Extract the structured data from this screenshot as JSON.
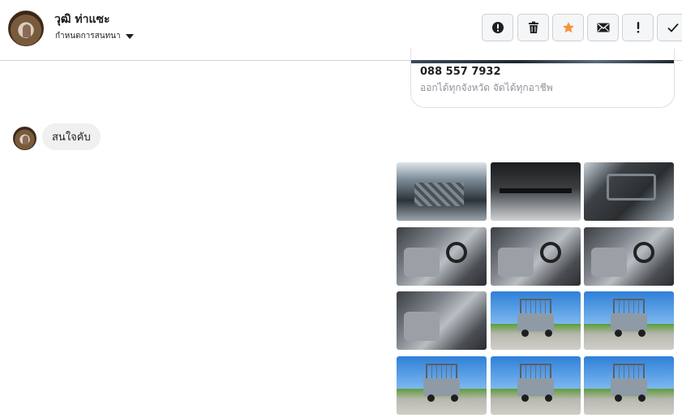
{
  "header": {
    "contact_name": "วุฒิ ท่าแซะ",
    "subtitle": "กำหนดการสนทนา",
    "toolbar": [
      {
        "name": "report-button",
        "icon": "exclamation-circle-icon"
      },
      {
        "name": "delete-button",
        "icon": "trash-icon"
      },
      {
        "name": "star-button",
        "icon": "star-icon",
        "color": "#f7923b"
      },
      {
        "name": "mark-unread-button",
        "icon": "envelope-icon"
      },
      {
        "name": "spam-button",
        "icon": "exclamation-icon"
      },
      {
        "name": "mark-done-button",
        "icon": "check-icon"
      }
    ]
  },
  "business_card": {
    "phone": "088 557 7932",
    "description": "ออกได้ทุกจังหวัด จัดได้ทุกอาชีพ"
  },
  "incoming_message": {
    "text": "สนใจคับ"
  },
  "photo_grid": {
    "photos": [
      {
        "subject": "engine-bay"
      },
      {
        "subject": "undercarriage"
      },
      {
        "subject": "door-panel"
      },
      {
        "subject": "interior-driver"
      },
      {
        "subject": "interior-passenger"
      },
      {
        "subject": "interior-dashboard"
      },
      {
        "subject": "interior-gearshift"
      },
      {
        "subject": "truck-rear-left"
      },
      {
        "subject": "truck-rear"
      },
      {
        "subject": "truck-side-left"
      },
      {
        "subject": "truck-front"
      },
      {
        "subject": "truck-rear-2"
      }
    ]
  },
  "colors": {
    "accent_star": "#f7923b",
    "bubble_incoming": "#f1f0f0",
    "divider": "#d0d2d6"
  }
}
